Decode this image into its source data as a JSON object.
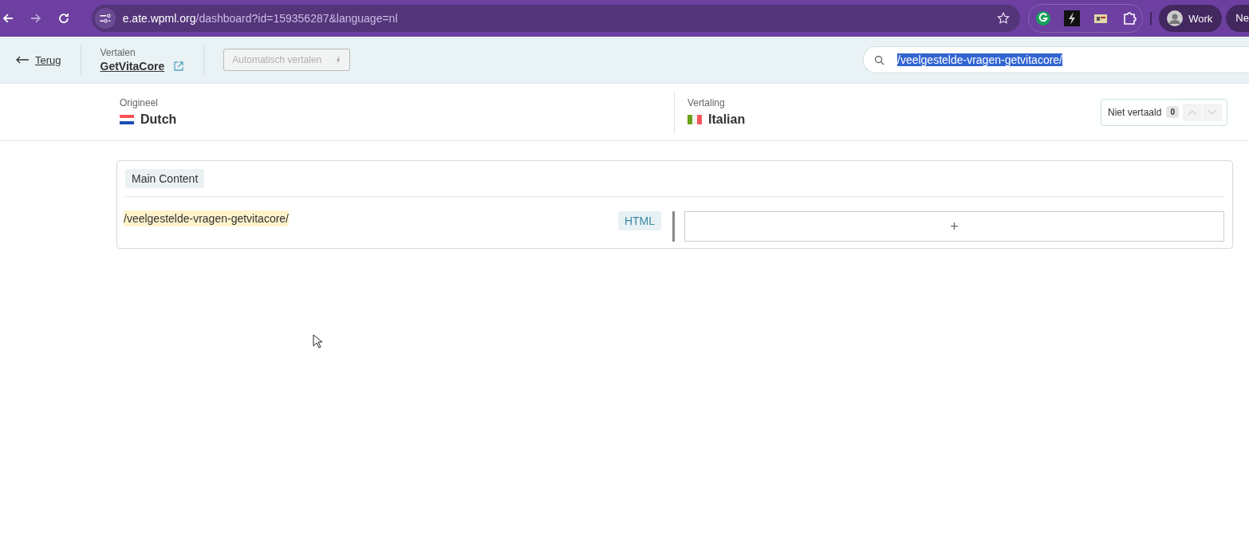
{
  "browser": {
    "url_host": "e.ate.wpml.org",
    "url_path": "/dashboard?id=159356287&language=nl",
    "profile": "Work",
    "next_profile": "Ne"
  },
  "header": {
    "back": "Terug",
    "project_label": "Vertalen",
    "project": "GetVitaCore",
    "auto_translate": {
      "label": "Automatisch vertalen",
      "disabled": true
    },
    "search": {
      "value": "/veelgestelde-vragen-getvitacore/",
      "selected": true
    }
  },
  "languages": {
    "source_label": "Origineel",
    "source": "Dutch",
    "target_label": "Vertaling",
    "target": "Italian"
  },
  "filter": {
    "label": "Niet vertaald",
    "count": "0"
  },
  "section": {
    "title": "Main Content",
    "rows": [
      {
        "source": "/veelgestelde-vragen-getvitacore/",
        "highlighted": true,
        "format": "HTML",
        "add": "+"
      }
    ]
  }
}
